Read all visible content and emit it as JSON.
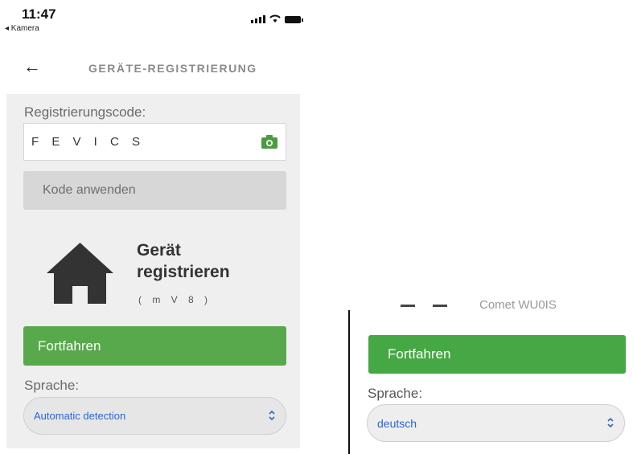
{
  "status_bar": {
    "time": "11:47",
    "back_app": "◂ Kamera"
  },
  "nav": {
    "title": "GERÄTE-REGISTRIERUNG"
  },
  "registration": {
    "label": "Registrierungscode:",
    "code_value": "F E V I C S",
    "apply_label": "Kode anwenden"
  },
  "device": {
    "title_line1": "Gerät",
    "title_line2": "registrieren",
    "id": "( m V 8 )"
  },
  "left_screen": {
    "continue_label": "Fortfahren",
    "language_label": "Sprache:",
    "language_value": "Automatic detection"
  },
  "right_screen": {
    "partial_text": "Comet WU0IS",
    "continue_label": "Fortfahren",
    "language_label": "Sprache:",
    "language_value": "deutsch"
  },
  "colors": {
    "continue_green": "#58a94b",
    "select_text_blue": "#2c64d6",
    "apply_gray": "#d7d7d7"
  }
}
